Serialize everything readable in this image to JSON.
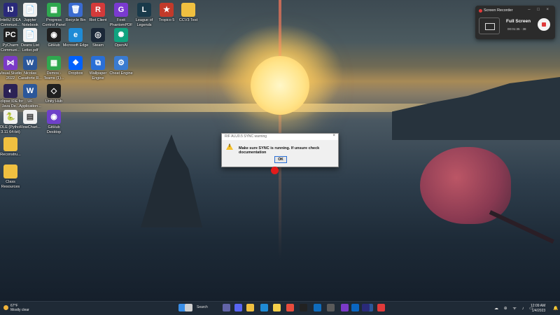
{
  "desktop": {
    "icons": [
      {
        "id": "intellij",
        "label": "IntelliJ IDEA Communi...",
        "color": "#2a2a7a",
        "glyph": "IJ"
      },
      {
        "id": "jupyter",
        "label": "Jupyter Notebook",
        "color": "#f1f1f1",
        "glyph": "📄"
      },
      {
        "id": "progress",
        "label": "Progress Control Panel",
        "color": "#2fa84f",
        "glyph": "▦"
      },
      {
        "id": "recycle",
        "label": "Recycle Bin",
        "color": "#3a6bd0",
        "glyph": "🗑"
      },
      {
        "id": "riot",
        "label": "Riot Client",
        "color": "#d33a3a",
        "glyph": "R"
      },
      {
        "id": "foxit",
        "label": "Foxit PhantomPDF",
        "color": "#7a3ad0",
        "glyph": "G"
      },
      {
        "id": "lol",
        "label": "League of Legends",
        "color": "#1a3a4a",
        "glyph": "L"
      },
      {
        "id": "tropico",
        "label": "Tropico 5",
        "color": "#c23a2a",
        "glyph": "★"
      },
      {
        "id": "ccv3",
        "label": "CCV3 Test",
        "color": "#f0c040",
        "glyph": ""
      },
      {
        "id": "pycharm",
        "label": "PyCharm Communi...",
        "color": "#1f1f1f",
        "glyph": "PC"
      },
      {
        "id": "deans",
        "label": "Deans List Letter.pdf",
        "color": "#f1f1f1",
        "glyph": "📄"
      },
      {
        "id": "github",
        "label": "GitHub",
        "color": "#1f1f1f",
        "glyph": "◉"
      },
      {
        "id": "edge",
        "label": "Microsoft Edge",
        "color": "#1f8bd6",
        "glyph": "e"
      },
      {
        "id": "steam",
        "label": "Steam",
        "color": "#1b2838",
        "glyph": "◎"
      },
      {
        "id": "openai",
        "label": "OpenAI",
        "color": "#10a37f",
        "glyph": "✺"
      },
      {
        "id": "vs",
        "label": "Visual Studio 2022",
        "color": "#7b3ac7",
        "glyph": "⋈"
      },
      {
        "id": "nicolas",
        "label": "Nicolas Casaforte R...",
        "color": "#2b579a",
        "glyph": "W"
      },
      {
        "id": "demos",
        "label": "Demos - Teams (1)...",
        "color": "#2fa84f",
        "glyph": "▦"
      },
      {
        "id": "dropbox",
        "label": "Dropbox",
        "color": "#0061fe",
        "glyph": "❖"
      },
      {
        "id": "wallpaper",
        "label": "Wallpaper Engine",
        "color": "#2a6fd6",
        "glyph": "⧉"
      },
      {
        "id": "cheat",
        "label": "Cheat Engine",
        "color": "#3a7bd0",
        "glyph": "⚙"
      },
      {
        "id": "eclipse",
        "label": "Eclipse IDE for Java De...",
        "color": "#2c2255",
        "glyph": "◐"
      },
      {
        "id": "uf",
        "label": "UF Application...",
        "color": "#2b579a",
        "glyph": "W"
      },
      {
        "id": "unity",
        "label": "Unity Hub",
        "color": "#1f1f1f",
        "glyph": "◇"
      },
      {
        "id": "idle",
        "label": "IDLE (Python 3.11 64-bit)",
        "color": "#f1f1f1",
        "glyph": "🐍"
      },
      {
        "id": "flowchart",
        "label": "FlowChart...",
        "color": "#f1f1f1",
        "glyph": "▤"
      },
      {
        "id": "githubdesk",
        "label": "GitHub Desktop",
        "color": "#6e40c9",
        "glyph": "◉"
      },
      {
        "id": "reconstru",
        "label": "Reconstru...",
        "color": "#f0c040",
        "glyph": ""
      },
      {
        "id": "class",
        "label": "Class Resources",
        "color": "#f0c040",
        "glyph": ""
      }
    ]
  },
  "recorder": {
    "title": "Screen Recorder",
    "mode": "Full Screen",
    "timer": "00:01:35 · 38",
    "controls": "– □ ×"
  },
  "dialog": {
    "title": "RIF ALU0.5 SYNC warning",
    "message": "Make sure SYNC is running. If unsure check documentation",
    "ok_label": "OK",
    "close_label": "×"
  },
  "taskbar": {
    "weather_temp": "67°F",
    "weather_desc": "Mostly clear",
    "search_label": "Search",
    "apps": [
      {
        "id": "start",
        "color": "#3a8ee6"
      },
      {
        "id": "taskview",
        "color": "#cfcfcf"
      },
      {
        "id": "teams",
        "color": "#6264a7"
      },
      {
        "id": "discord",
        "color": "#5865f2"
      },
      {
        "id": "explorer",
        "color": "#f0c040"
      },
      {
        "id": "edge",
        "color": "#1f8bd6"
      },
      {
        "id": "notes",
        "color": "#f5d04a"
      },
      {
        "id": "chrome",
        "color": "#e84c3d"
      },
      {
        "id": "github",
        "color": "#222"
      },
      {
        "id": "outlook",
        "color": "#0f6cbd"
      },
      {
        "id": "obs",
        "color": "#5a5a5a"
      },
      {
        "id": "git",
        "color": "#7a3ac7"
      },
      {
        "id": "linkedin",
        "color": "#0a66c2"
      },
      {
        "id": "word",
        "color": "#2b579a"
      },
      {
        "id": "intellij",
        "color": "#2a2a7a"
      },
      {
        "id": "recorder",
        "color": "#e03a3a"
      }
    ],
    "tray_icons": "☁ ⊕ ᯤ ♪ ▭",
    "time": "12:09 AM",
    "date": "1/4/2023"
  }
}
